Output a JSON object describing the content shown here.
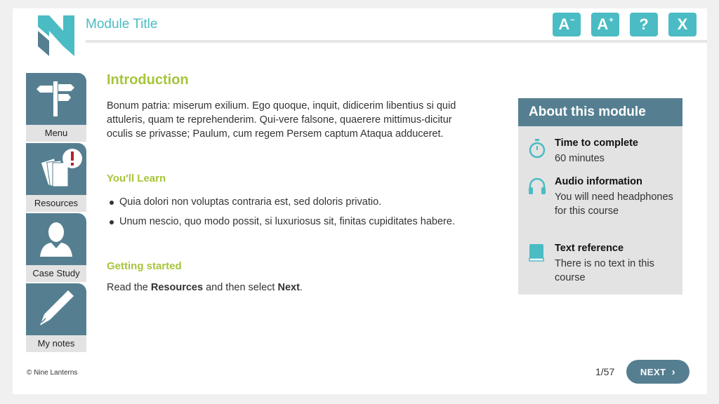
{
  "header": {
    "module_title": "Module Title",
    "buttons": {
      "font_smaller": "A",
      "font_smaller_sup": "−",
      "font_larger": "A",
      "font_larger_sup": "+",
      "help": "?",
      "close": "X"
    }
  },
  "sidebar": {
    "items": [
      {
        "label": "Menu",
        "icon": "signpost-icon"
      },
      {
        "label": "Resources",
        "icon": "resources-alert-icon"
      },
      {
        "label": "Case Study",
        "icon": "person-icon"
      },
      {
        "label": "My notes",
        "icon": "pen-icon"
      }
    ]
  },
  "content": {
    "heading": "Introduction",
    "intro": "Bonum patria: miserum exilium. Ego quoque, inquit, didicerim libentius si quid attuleris, quam te reprehenderim. Qui-vere falsone, quaerere mittimus-dicitur oculis se privasse; Paulum, cum regem Persem captum Ataqua adduceret.",
    "learn_heading": "You'll Learn",
    "learn_items": [
      "Quia dolori non voluptas contraria est, sed doloris privatio.",
      "Unum nescio, quo modo possit, si luxuriosus sit, finitas cupiditates habere."
    ],
    "started_heading": "Getting started",
    "started_pre": "Read the ",
    "started_bold1": "Resources",
    "started_mid": " and then select ",
    "started_bold2": "Next",
    "started_post": "."
  },
  "about": {
    "title": "About this module",
    "items": [
      {
        "title": "Time to complete",
        "text": "60 minutes",
        "icon": "stopwatch-icon"
      },
      {
        "title": "Audio information",
        "text": "You will need headphones for this course",
        "icon": "headphones-icon"
      },
      {
        "title": "Text reference",
        "text": "There is no text in this course",
        "icon": "book-icon"
      }
    ]
  },
  "footer": {
    "copyright": "© Nine Lanterns",
    "page": "1/57",
    "next_label": "NEXT",
    "next_chevron": "›"
  },
  "colors": {
    "teal": "#4bbcc4",
    "slate": "#557f91",
    "green": "#a7c43c",
    "panel_grey": "#e3e3e3"
  }
}
